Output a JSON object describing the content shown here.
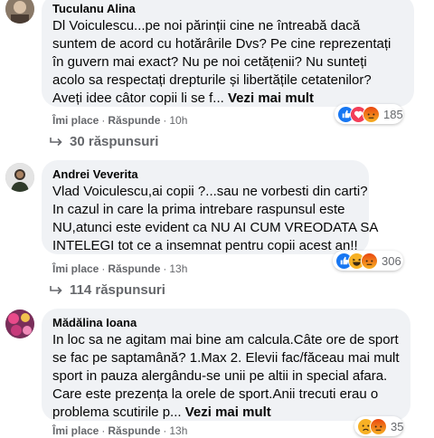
{
  "comments": [
    {
      "author": "Tuculanu Alina",
      "lines": [
        "Dl Voiculescu...pe noi părinții cine ne întreabă dacă",
        "suntem de acord cu hotărârile Dvs? Pe cine reprezentați",
        "în guvern mai exact? Nu pe noi cetățenii? Nu sunteți",
        "acolo sa respectați drepturile și libertățile cetatenilor?",
        "Aveți idee câtor copii li se f... "
      ],
      "see_more": "Vezi mai mult",
      "like_label": "Îmi place",
      "reply_label": "Răspunde",
      "time": "10h",
      "reaction_icons": [
        "like-icon",
        "love-icon",
        "angry-icon"
      ],
      "reaction_count": "185",
      "replies_label": "30 răspunsuri"
    },
    {
      "author": "Andrei Veverita",
      "lines": [
        "Vlad Voiculescu,ai copii ?...sau ne vorbesti din carti?",
        "In cazul in care la prima intrebare raspunsul este",
        "NU,atunci este evident ca NU AI CUM VREODATA SA",
        "INTELEGI tot ce a insemnat pentru copii acest an!!"
      ],
      "like_label": "Îmi place",
      "reply_label": "Răspunde",
      "time": "13h",
      "reaction_icons": [
        "like-icon",
        "haha-icon",
        "angry-icon"
      ],
      "reaction_count": "306",
      "replies_label": "114 răspunsuri"
    },
    {
      "author": "Mădălina Ioana",
      "lines": [
        "In loc sa ne agitam mai bine am calcula.Câte ore de sport",
        "se fac pe saptamână? 1.Max 2. Elevii fac/făceau mai mult",
        "sport in pauza alergându-se unii pe altii in special afara.",
        "Care este prezența la orele de sport.Anii trecuti erau o",
        "problema scutirile p... "
      ],
      "see_more": "Vezi mai mult",
      "like_label": "Îmi place",
      "reply_label": "Răspunde",
      "time": "13h",
      "reaction_icons": [
        "sad-icon",
        "angry-icon"
      ],
      "reaction_count": "35"
    }
  ],
  "colors": {
    "bubble": "#f0f2f5",
    "meta": "#65676b",
    "like": "#1877f2",
    "love": "#f33e58",
    "angry": "#e9710f",
    "haha": "#f7b125"
  }
}
